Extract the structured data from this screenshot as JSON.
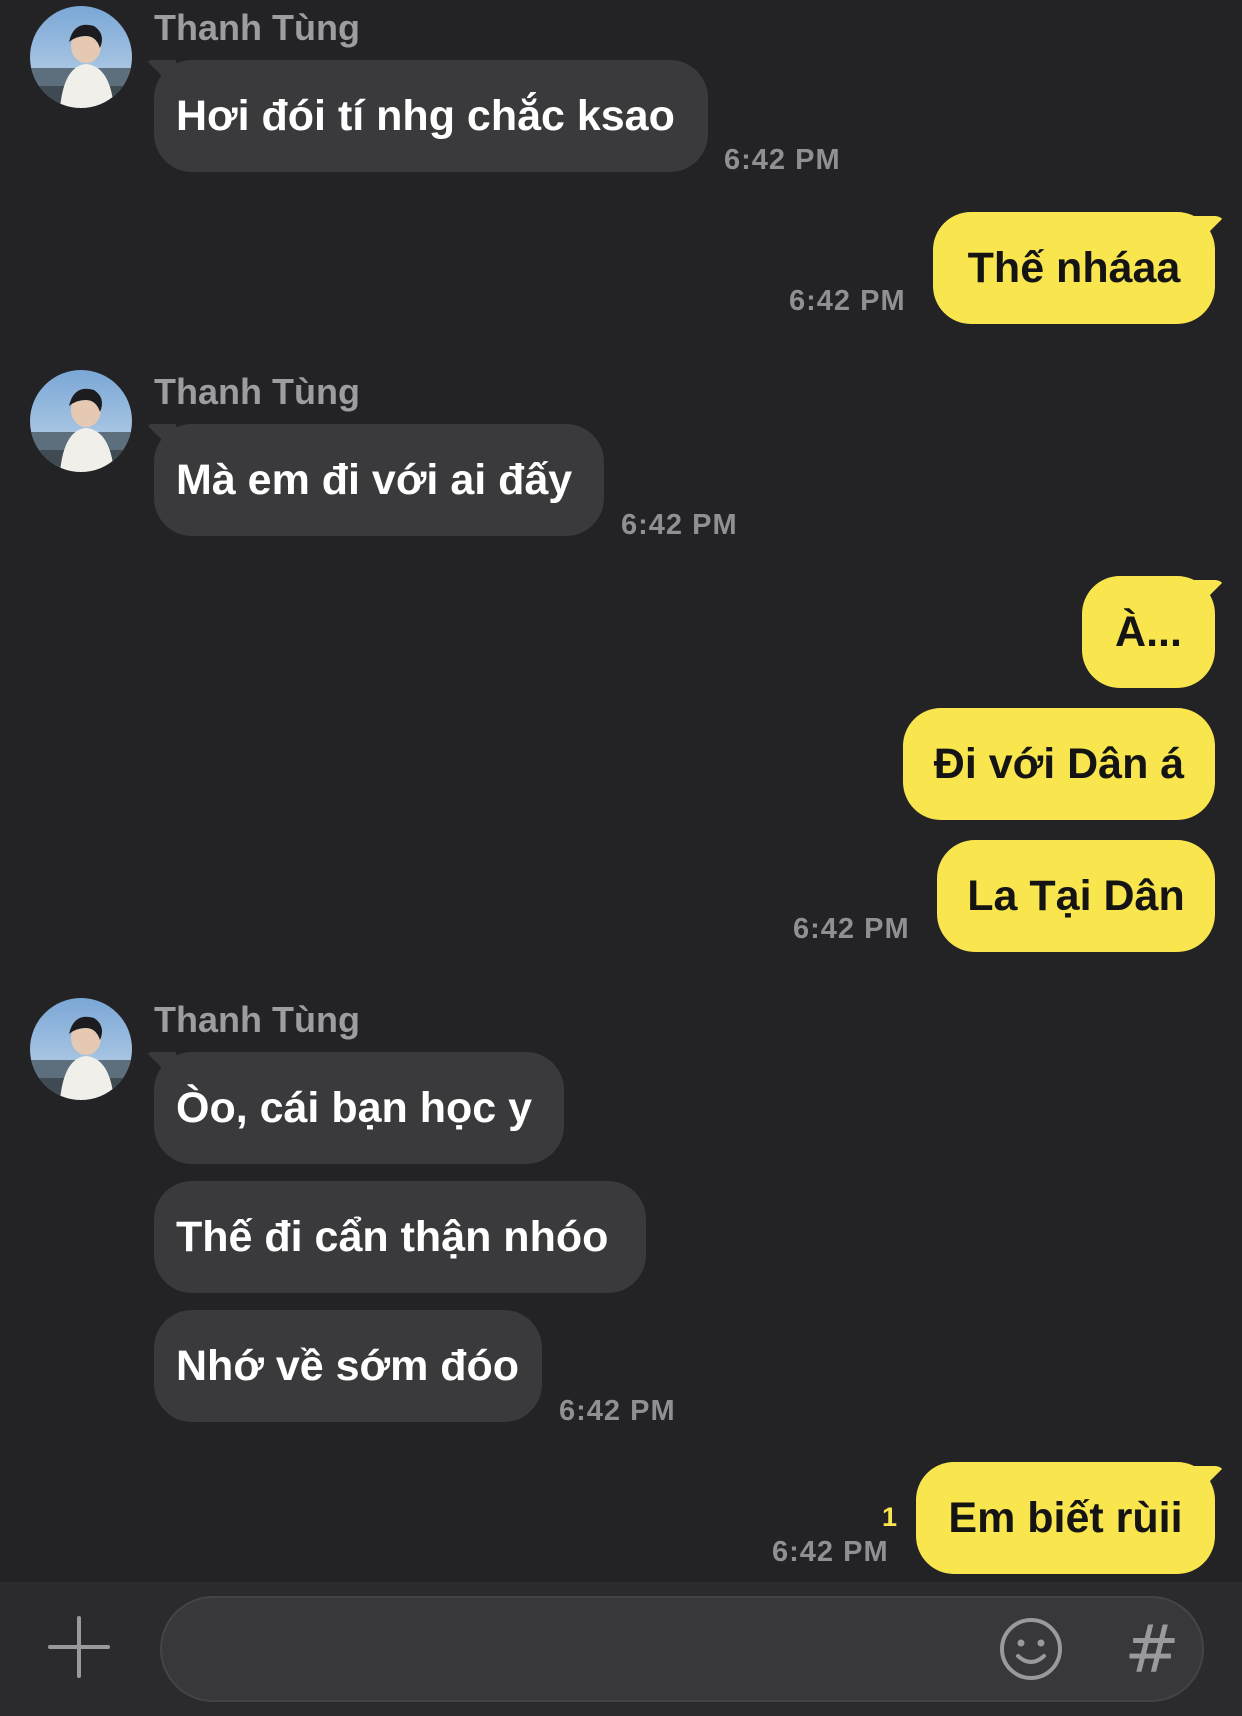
{
  "contact": {
    "name": "Thanh Tùng",
    "avatar_icon": "user-photo-avatar"
  },
  "colors": {
    "background": "#232325",
    "incoming_bubble": "#3a3a3d",
    "outgoing_bubble": "#f9e54d",
    "timestamp": "#8f8f94"
  },
  "groups": [
    {
      "direction": "in",
      "sender": "Thanh Tùng",
      "messages": [
        "Hơi đói tí nhg chắc ksao"
      ],
      "time": "6:42 PM"
    },
    {
      "direction": "out",
      "messages": [
        "Thế nháaa"
      ],
      "time": "6:42 PM"
    },
    {
      "direction": "in",
      "sender": "Thanh Tùng",
      "messages": [
        "Mà em đi với ai đấy"
      ],
      "time": "6:42 PM"
    },
    {
      "direction": "out",
      "messages": [
        "À...",
        "Đi với Dân á",
        "La Tại Dân"
      ],
      "time": "6:42 PM"
    },
    {
      "direction": "in",
      "sender": "Thanh Tùng",
      "messages": [
        "Òo, cái bạn học y",
        "Thế đi cẩn thận nhóo",
        "Nhớ về sớm đóo"
      ],
      "time": "6:42 PM"
    },
    {
      "direction": "out",
      "messages": [
        "Em biết rùii"
      ],
      "time": "6:42 PM",
      "unread_count": "1"
    }
  ],
  "composer": {
    "placeholder": "",
    "value": "",
    "plus_icon": "plus-icon",
    "emoji_icon": "emoji-icon",
    "hash_icon": "hash-icon",
    "hash_glyph": "#"
  }
}
